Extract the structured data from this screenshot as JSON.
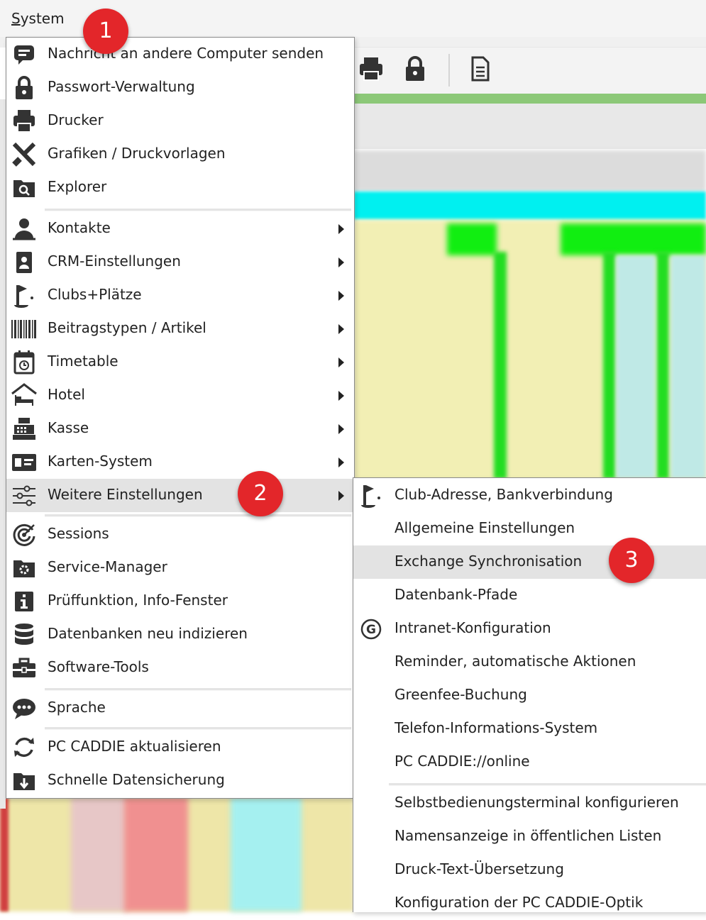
{
  "menubar": {
    "system_label_first": "S",
    "system_label_rest": "ystem"
  },
  "badges": [
    "1",
    "2",
    "3"
  ],
  "system_menu": {
    "items": [
      {
        "icon": "message-icon",
        "label": "Nachricht an andere Computer senden",
        "submenu": false
      },
      {
        "icon": "lock-icon",
        "label": "Passwort-Verwaltung",
        "submenu": false
      },
      {
        "icon": "printer-icon",
        "label": "Drucker",
        "submenu": false
      },
      {
        "icon": "graphics-tools-icon",
        "label": "Grafiken / Druckvorlagen",
        "submenu": false
      },
      {
        "icon": "explorer-icon",
        "label": "Explorer",
        "submenu": false
      },
      {
        "icon": "contacts-icon",
        "label": "Kontakte",
        "submenu": true
      },
      {
        "icon": "crm-icon",
        "label": "CRM-Einstellungen",
        "submenu": true
      },
      {
        "icon": "golf-flag-icon",
        "label": "Clubs+Plätze",
        "submenu": true
      },
      {
        "icon": "barcode-icon",
        "label": "Beitragstypen / Artikel",
        "submenu": true
      },
      {
        "icon": "calendar-clock-icon",
        "label": "Timetable",
        "submenu": true
      },
      {
        "icon": "hotel-icon",
        "label": "Hotel",
        "submenu": true
      },
      {
        "icon": "cash-register-icon",
        "label": "Kasse",
        "submenu": true
      },
      {
        "icon": "card-icon",
        "label": "Karten-System",
        "submenu": true
      },
      {
        "icon": "sliders-icon",
        "label": "Weitere Einstellungen",
        "submenu": true,
        "highlighted": true
      },
      {
        "icon": "sessions-icon",
        "label": "Sessions",
        "submenu": false
      },
      {
        "icon": "service-folder-icon",
        "label": "Service-Manager",
        "submenu": false
      },
      {
        "icon": "info-icon",
        "label": "Prüffunktion, Info-Fenster",
        "submenu": false
      },
      {
        "icon": "database-icon",
        "label": "Datenbanken neu indizieren",
        "submenu": false
      },
      {
        "icon": "toolbox-icon",
        "label": "Software-Tools",
        "submenu": false
      },
      {
        "icon": "speech-bubble-icon",
        "label": "Sprache",
        "submenu": false
      },
      {
        "icon": "refresh-icon",
        "label": "PC CADDIE aktualisieren",
        "submenu": false
      },
      {
        "icon": "download-folder-icon",
        "label": "Schnelle Datensicherung",
        "submenu": false
      }
    ]
  },
  "submenu": {
    "items": [
      {
        "icon": "golf-flag-icon",
        "label": "Club-Adresse, Bankverbindung"
      },
      {
        "icon": "",
        "label": "Allgemeine Einstellungen"
      },
      {
        "icon": "",
        "label": "Exchange Synchronisation",
        "highlighted": true
      },
      {
        "icon": "",
        "label": "Datenbank-Pfade"
      },
      {
        "icon": "g-circle-icon",
        "label": "Intranet-Konfiguration"
      },
      {
        "icon": "",
        "label": "Reminder, automatische Aktionen"
      },
      {
        "icon": "",
        "label": "Greenfee-Buchung"
      },
      {
        "icon": "",
        "label": "Telefon-Informations-System"
      },
      {
        "icon": "",
        "label": "PC CADDIE://online"
      },
      {
        "icon": "",
        "label": "Selbstbedienungsterminal konfigurieren"
      },
      {
        "icon": "",
        "label": "Namensanzeige in öffentlichen Listen"
      },
      {
        "icon": "",
        "label": "Druck-Text-Übersetzung"
      },
      {
        "icon": "",
        "label": "Konfiguration der PC CADDIE-Optik"
      }
    ]
  },
  "colors": {
    "badge": "#e3262a",
    "highlight": "#e3e3e3",
    "green_bar": "#8cc878",
    "cyan_band": "#00f0f0",
    "grid_green": "#22dd22",
    "grid_yellow": "#f2efb4"
  }
}
